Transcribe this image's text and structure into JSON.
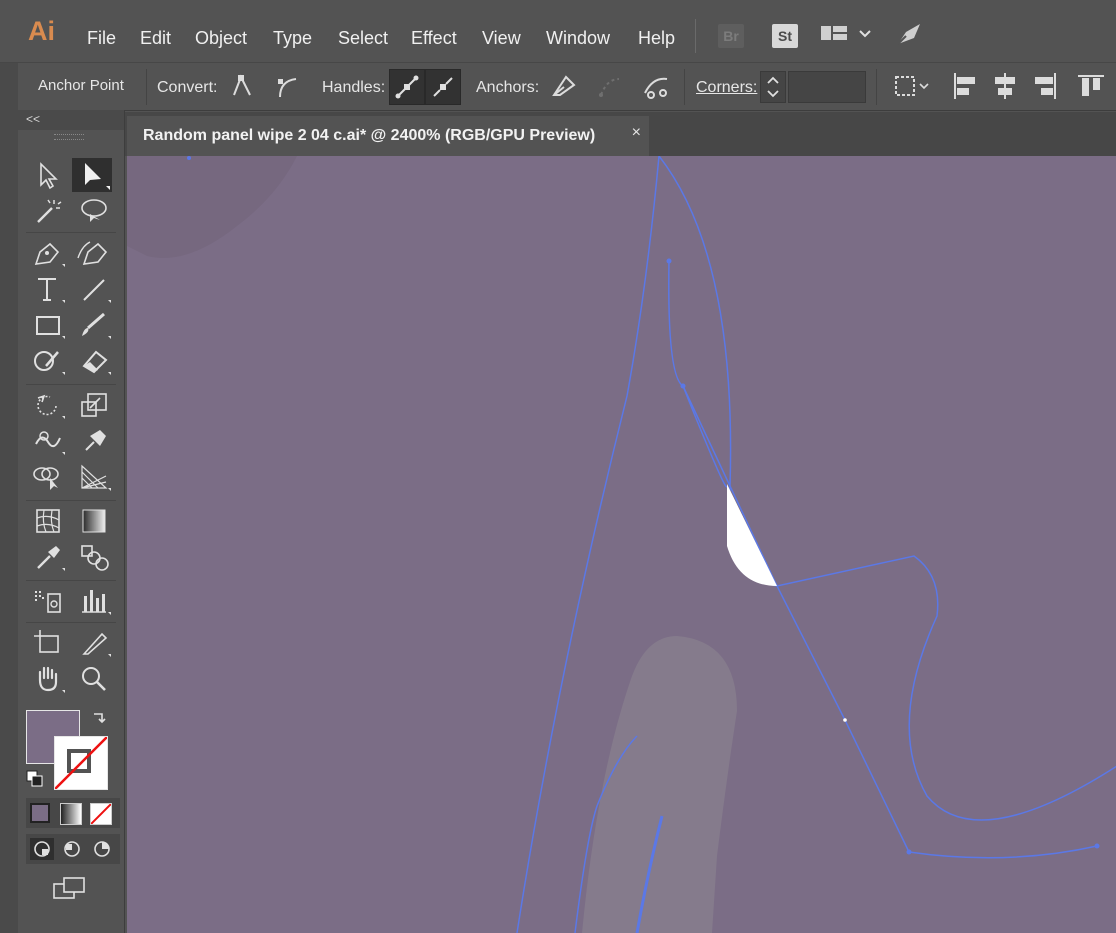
{
  "app": {
    "logo": "Ai",
    "menus": [
      "File",
      "Edit",
      "Object",
      "Type",
      "Select",
      "Effect",
      "View",
      "Window",
      "Help"
    ],
    "bridge_label": "Br",
    "stock_label": "St"
  },
  "control_bar": {
    "title": "Anchor Point",
    "convert_label": "Convert:",
    "handles_label": "Handles:",
    "anchors_label": "Anchors:",
    "corners_label": "Corners:",
    "corners_value": ""
  },
  "document": {
    "tab_title": "Random panel wipe 2 04 c.ai* @ 2400% (RGB/GPU Preview)",
    "close_glyph": "×"
  },
  "toolbar": {
    "collapse_glyph": "<<",
    "tools": [
      "selection-tool",
      "direct-selection-tool",
      "magic-wand-tool",
      "lasso-tool",
      "pen-tool",
      "curvature-tool",
      "type-tool",
      "line-segment-tool",
      "rectangle-tool",
      "paintbrush-tool",
      "shaper-tool",
      "eraser-tool",
      "rotate-tool",
      "scale-tool",
      "warp-tool",
      "puppet-warp-tool",
      "shape-builder-tool",
      "perspective-grid-tool",
      "mesh-tool",
      "gradient-tool",
      "eyedropper-tool",
      "blend-tool",
      "symbol-sprayer-tool",
      "column-graph-tool",
      "artboard-tool",
      "slice-tool",
      "hand-tool",
      "zoom-tool"
    ],
    "active_tool": "direct-selection-tool"
  },
  "colors": {
    "fill": "#7b6d86",
    "stroke": "none",
    "canvas": "#7b6d86",
    "path_highlight": "#5b78e6",
    "menu_bg": "#535353",
    "logo_color": "#d98b4f"
  }
}
